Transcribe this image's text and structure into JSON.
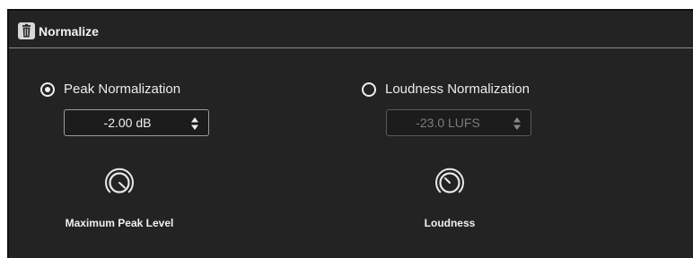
{
  "section": {
    "title": "Normalize",
    "icons": {
      "delete": "trash-icon"
    }
  },
  "peak": {
    "radio_label": "Peak Normalization",
    "selected": true,
    "value": "-2.00 dB",
    "knob_label": "Maximum Peak Level",
    "knob_icon": "knob-icon"
  },
  "loudness": {
    "radio_label": "Loudness Normalization",
    "selected": false,
    "value": "-23.0 LUFS",
    "knob_label": "Loudness",
    "knob_icon": "knob-icon"
  },
  "colors": {
    "panel_bg": "#232323",
    "field_bg": "#1c1c1c",
    "text": "#e8e8e8",
    "disabled_text": "#7c7c7c"
  }
}
